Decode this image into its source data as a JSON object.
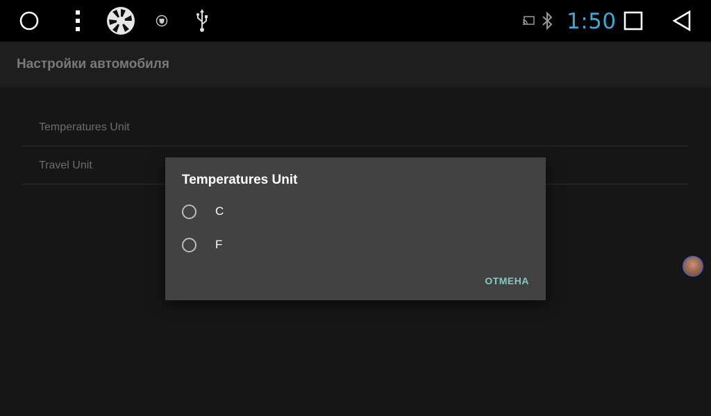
{
  "status_bar": {
    "time": "1:50",
    "icons": [
      "home-circle-icon",
      "menu-dots-icon",
      "camera-shutter-icon",
      "vpn-shield-icon",
      "usb-icon",
      "cast-icon",
      "bluetooth-icon",
      "recents-square-icon",
      "back-triangle-icon"
    ],
    "clock_color": "#3fa9d6"
  },
  "app_bar": {
    "title": "Настройки автомобиля"
  },
  "settings_list": {
    "items": [
      {
        "label": "Temperatures Unit"
      },
      {
        "label": "Travel Unit"
      }
    ]
  },
  "dialog": {
    "title": "Temperatures Unit",
    "options": [
      {
        "label": "C",
        "selected": false
      },
      {
        "label": "F",
        "selected": false
      }
    ],
    "cancel_label": "ОТМЕНА",
    "accent_color": "#80cbc4"
  }
}
